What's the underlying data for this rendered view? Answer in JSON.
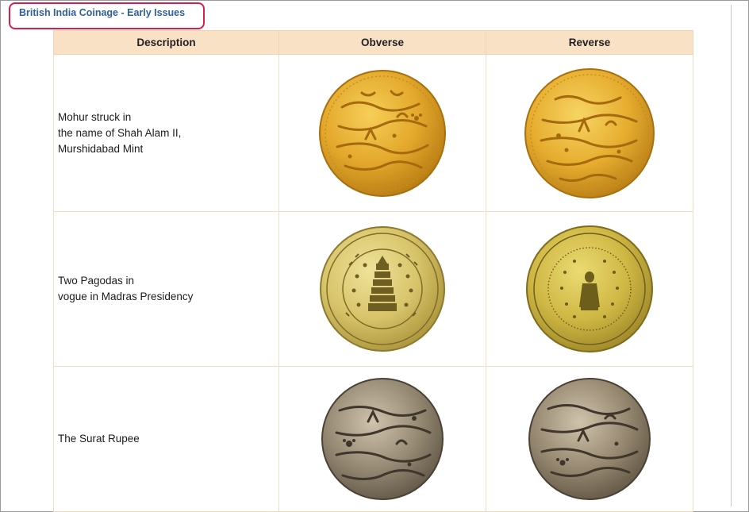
{
  "page": {
    "heading": "British India Coinage - Early Issues"
  },
  "table": {
    "headers": [
      "Description",
      "Obverse",
      "Reverse"
    ],
    "rows": [
      {
        "description_lines": [
          "Mohur struck in",
          "the name of Shah Alam II,",
          "Murshidabad Mint"
        ],
        "obverse_icon": "gold-mohur-obverse-coin",
        "reverse_icon": "gold-mohur-reverse-coin"
      },
      {
        "description_lines": [
          "Two Pagodas in",
          "vogue in Madras Presidency"
        ],
        "obverse_icon": "two-pagodas-obverse-coin",
        "reverse_icon": "two-pagodas-reverse-coin"
      },
      {
        "description_lines": [
          "The Surat Rupee"
        ],
        "obverse_icon": "surat-rupee-obverse-coin",
        "reverse_icon": "surat-rupee-reverse-coin"
      }
    ]
  },
  "colors": {
    "heading": "#2f5f9e",
    "highlight_border": "#d81e4c",
    "header_bg": "#f9e1c6",
    "gold": "#e2a52a",
    "pale_gold": "#d8c86a",
    "silver": "#8e8272"
  }
}
